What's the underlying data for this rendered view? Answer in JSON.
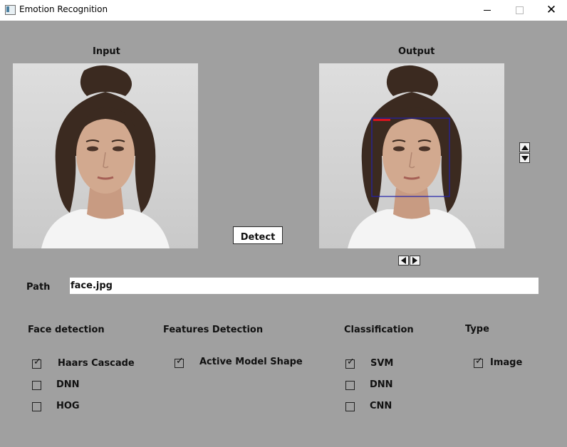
{
  "window": {
    "title": "Emotion Recognition"
  },
  "panels": {
    "input_label": "Input",
    "output_label": "Output",
    "detection_box_color": "#2222aa",
    "detection_tag_color": "#d8141e"
  },
  "detect_button": {
    "label": "Detect"
  },
  "path": {
    "label": "Path",
    "value": "face.jpg"
  },
  "face_detection": {
    "title": "Face detection",
    "options": [
      {
        "label": "Haars Cascade",
        "checked": true
      },
      {
        "label": "DNN",
        "checked": false
      },
      {
        "label": "HOG",
        "checked": false
      }
    ]
  },
  "features_detection": {
    "title": "Features Detection",
    "options": [
      {
        "label": "Active Model Shape",
        "checked": true
      }
    ]
  },
  "classification": {
    "title": "Classification",
    "options": [
      {
        "label": "SVM",
        "checked": true
      },
      {
        "label": "DNN",
        "checked": false
      },
      {
        "label": "CNN",
        "checked": false
      }
    ]
  },
  "type": {
    "title": "Type",
    "options": [
      {
        "label": "Image",
        "checked": true
      }
    ]
  },
  "icons": {
    "window_minimize": "minimize-icon",
    "window_maximize": "maximize-icon",
    "window_close": "close-icon",
    "scroll_up": "arrow-up-icon",
    "scroll_down": "arrow-down-icon",
    "prev": "arrow-left-icon",
    "next": "arrow-right-icon"
  }
}
